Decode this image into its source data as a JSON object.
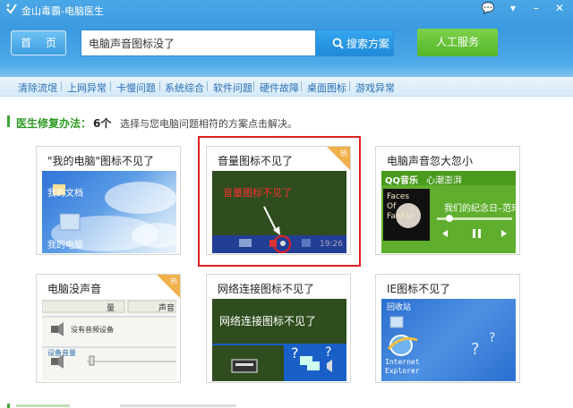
{
  "app": {
    "title": "金山毒霸-电脑医生",
    "window_controls": [
      "💬",
      "▾",
      "–",
      "✕"
    ]
  },
  "header": {
    "home_label": "首 页",
    "search_value": "电脑声音图标没了",
    "search_button": "搜索方案",
    "human_service": "人工服务"
  },
  "nav": {
    "items": [
      "清除流氓",
      "上网异常",
      "卡慢问题",
      "系统综合",
      "软件问题",
      "硬件故障",
      "桌面图标",
      "游戏异常"
    ]
  },
  "solutions": {
    "label": "医生修复办法：",
    "count": "6个",
    "description": "选择与您电脑问题相符的方案点击解决。"
  },
  "cards": [
    {
      "title": "\"我的电脑\"图标不见了",
      "hot": false,
      "thumb": {
        "label1": "我的文档",
        "label2": "我的电脑"
      }
    },
    {
      "title": "音量图标不见了",
      "hot": true,
      "hot_label": "热",
      "selected": true,
      "thumb": {
        "caption": "音量图标不见了",
        "clock": "19:26"
      }
    },
    {
      "title": "电脑声音忽大忽小",
      "hot": false,
      "thumb": {
        "app": "QQ音乐",
        "mood": "心潮澎湃",
        "song": "我们的纪念日–范玮",
        "album1": "Faces",
        "album2": "Of",
        "album3": "FanFan"
      }
    },
    {
      "title": "电脑没声音",
      "hot": true,
      "hot_label": "热",
      "thumb": {
        "col1": "量",
        "col2": "声音",
        "device": "没有音频设备",
        "volume": "设备音量"
      }
    },
    {
      "title": "网络连接图标不见了",
      "hot": false,
      "thumb": {
        "caption": "网络连接图标不见了"
      }
    },
    {
      "title": "IE图标不见了",
      "hot": false,
      "thumb": {
        "recycle": "回收站",
        "ie1": "Internet",
        "ie2": "Explorer"
      }
    }
  ],
  "colors": {
    "header_blue": "#3b9ae0",
    "nav_link": "#2b6fb3",
    "green_accent": "#41a63a",
    "human_green": "#53b52b",
    "hot_orange": "#f0b04a",
    "selected_red": "#e02020"
  }
}
